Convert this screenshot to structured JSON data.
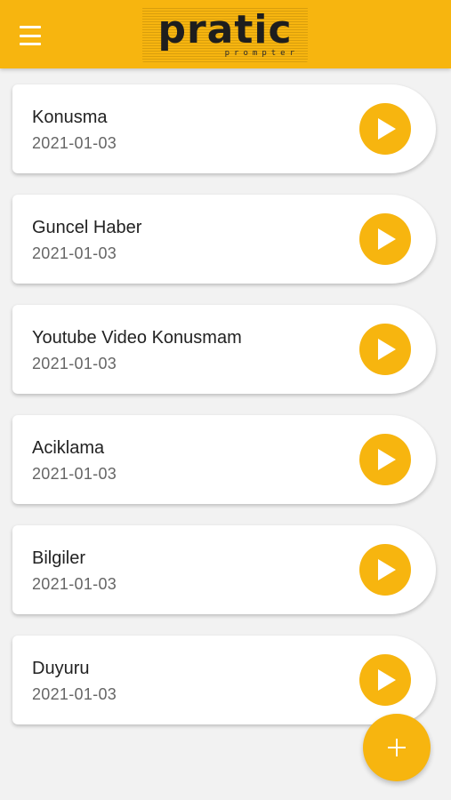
{
  "app": {
    "logo_text": "pratic",
    "logo_subtext": "prompter",
    "accent_color": "#f7b50f",
    "menu_icon": "hamburger-menu-icon"
  },
  "items": [
    {
      "title": "Konusma",
      "date": "2021-01-03",
      "action_icon": "play-icon"
    },
    {
      "title": "Guncel Haber",
      "date": "2021-01-03",
      "action_icon": "play-icon"
    },
    {
      "title": "Youtube Video Konusmam",
      "date": "2021-01-03",
      "action_icon": "play-icon"
    },
    {
      "title": "Aciklama",
      "date": "2021-01-03",
      "action_icon": "play-icon"
    },
    {
      "title": "Bilgiler",
      "date": "2021-01-03",
      "action_icon": "play-icon"
    },
    {
      "title": "Duyuru",
      "date": "2021-01-03",
      "action_icon": "play-icon"
    }
  ],
  "fab": {
    "icon": "plus-icon"
  }
}
